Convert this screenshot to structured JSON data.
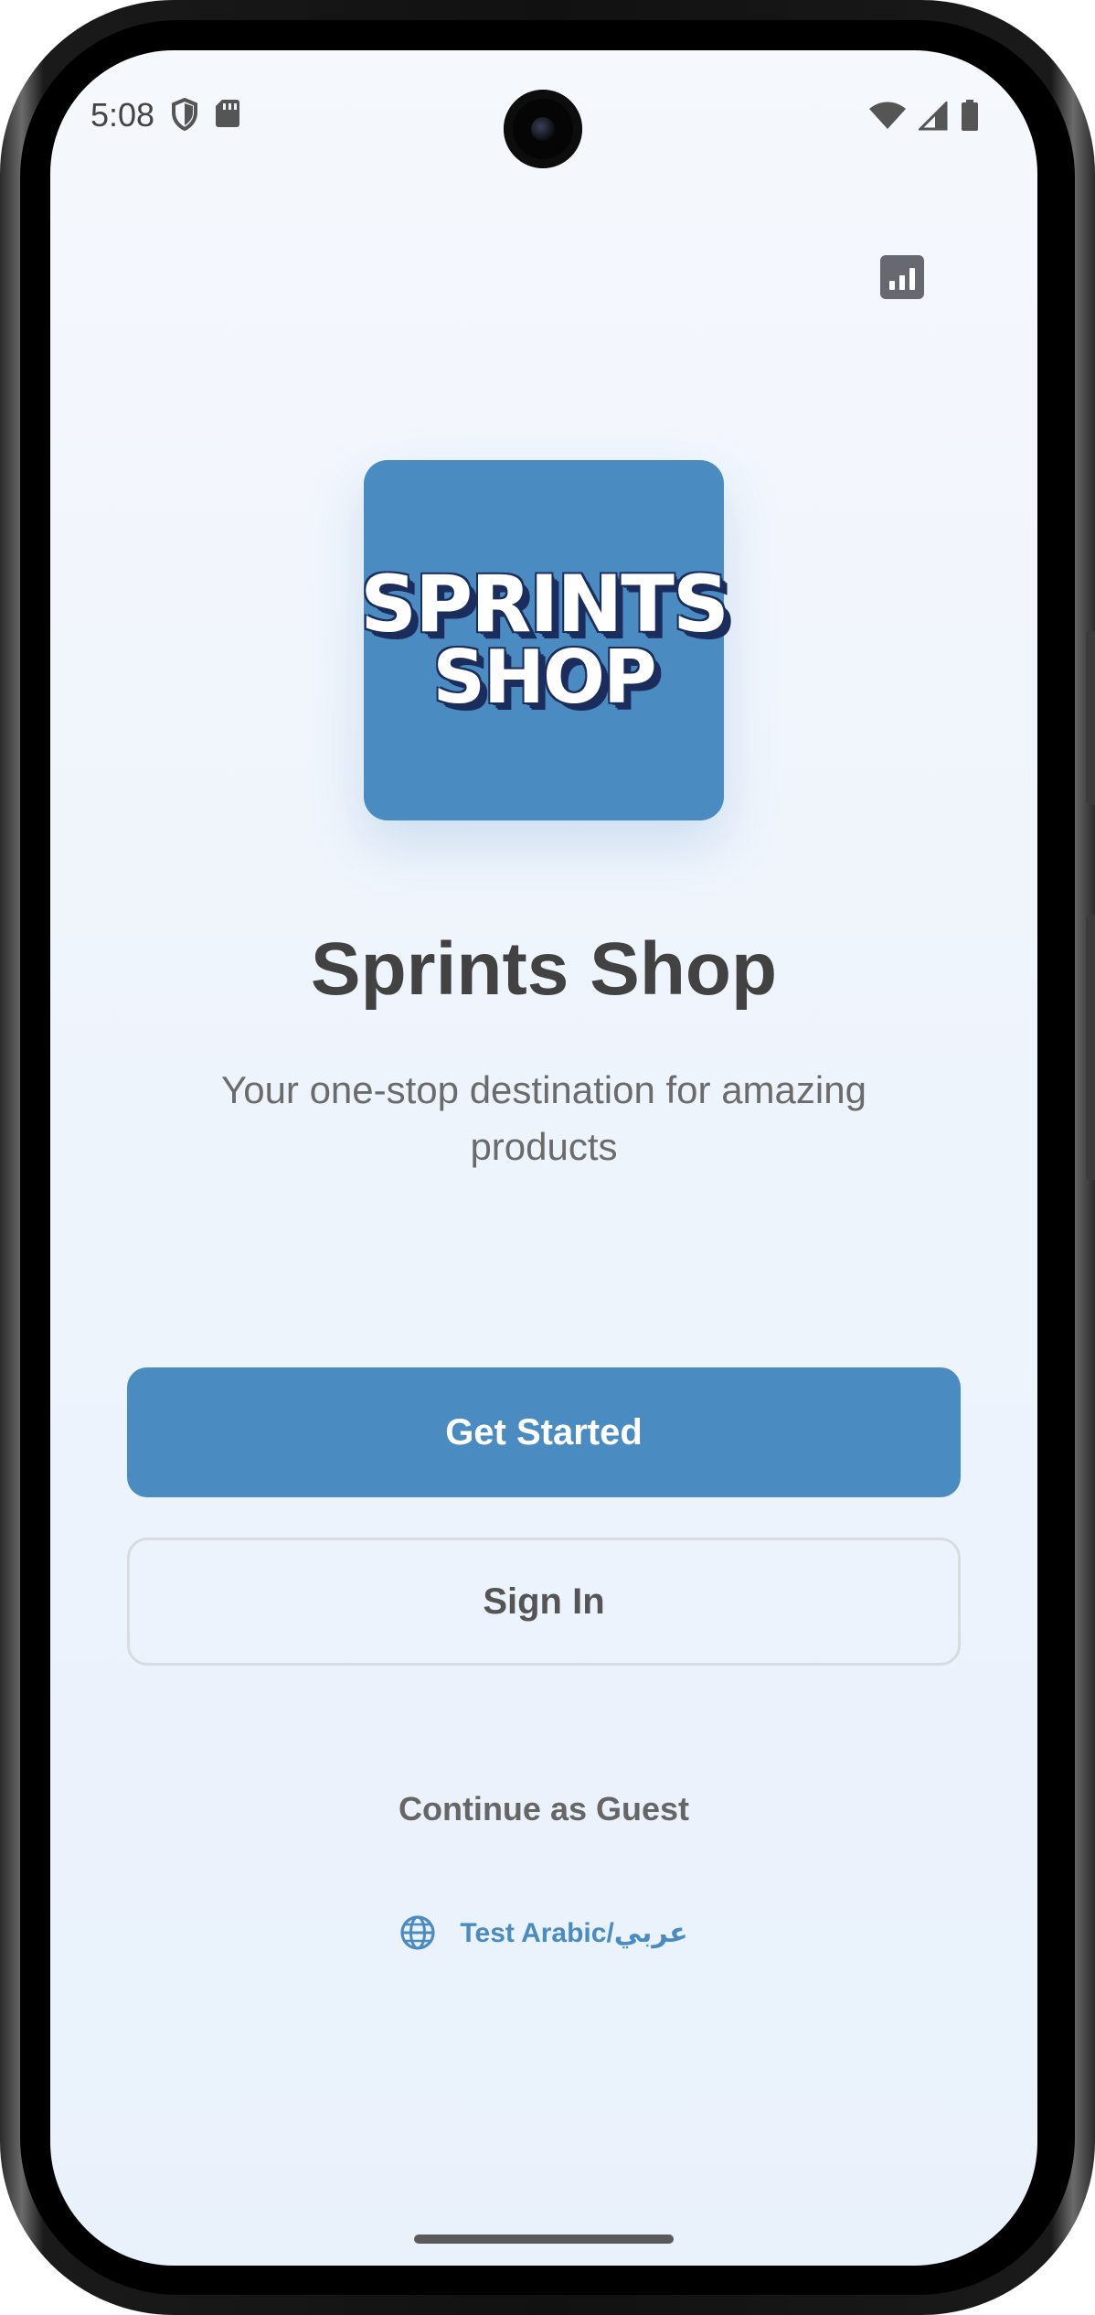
{
  "status_bar": {
    "time": "5:08",
    "left_icons": [
      "shield-icon",
      "sd-card-icon"
    ],
    "right_icons": [
      "wifi-icon",
      "signal-icon",
      "battery-icon"
    ]
  },
  "header": {
    "stats_icon": "bar-chart-icon"
  },
  "logo": {
    "line1": "SPRINTS",
    "line2": "SHOP",
    "background": "#4a8cc2"
  },
  "main": {
    "title": "Sprints Shop",
    "subtitle": "Your one-stop destination for amazing products"
  },
  "actions": {
    "get_started_label": "Get Started",
    "sign_in_label": "Sign In",
    "guest_label": "Continue as Guest",
    "language_label": "Test Arabic/عربي",
    "language_icon": "globe-icon"
  },
  "colors": {
    "accent": "#4a8cc2",
    "title": "#424242",
    "subtitle": "#6b6b6b",
    "background": "#eef4fc"
  }
}
